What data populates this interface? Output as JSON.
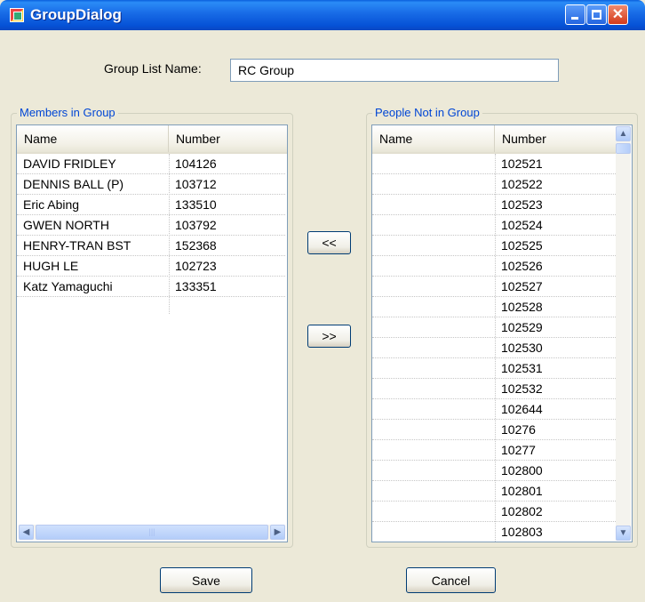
{
  "window": {
    "title": "GroupDialog"
  },
  "form": {
    "group_name_label": "Group List Name:",
    "group_name_value": "RC Group"
  },
  "members": {
    "legend": "Members in Group",
    "columns": [
      "Name",
      "Number"
    ],
    "rows": [
      {
        "name": "DAVID FRIDLEY",
        "number": "104126"
      },
      {
        "name": "DENNIS BALL (P)",
        "number": "103712"
      },
      {
        "name": "Eric Abing",
        "number": "133510"
      },
      {
        "name": "GWEN NORTH",
        "number": "103792"
      },
      {
        "name": "HENRY-TRAN BST",
        "number": "152368"
      },
      {
        "name": "HUGH LE",
        "number": "102723"
      },
      {
        "name": "Katz Yamaguchi",
        "number": "133351"
      }
    ]
  },
  "nonmembers": {
    "legend": "People Not in Group",
    "columns": [
      "Name",
      "Number"
    ],
    "rows": [
      {
        "name": "",
        "number": "102521"
      },
      {
        "name": "",
        "number": "102522"
      },
      {
        "name": "",
        "number": "102523"
      },
      {
        "name": "",
        "number": "102524"
      },
      {
        "name": "",
        "number": "102525"
      },
      {
        "name": "",
        "number": "102526"
      },
      {
        "name": "",
        "number": "102527"
      },
      {
        "name": "",
        "number": "102528"
      },
      {
        "name": "",
        "number": "102529"
      },
      {
        "name": "",
        "number": "102530"
      },
      {
        "name": "",
        "number": "102531"
      },
      {
        "name": "",
        "number": "102532"
      },
      {
        "name": "",
        "number": "102644"
      },
      {
        "name": "",
        "number": "10276"
      },
      {
        "name": "",
        "number": "10277"
      },
      {
        "name": "",
        "number": "102800"
      },
      {
        "name": "",
        "number": "102801"
      },
      {
        "name": "",
        "number": "102802"
      },
      {
        "name": "",
        "number": "102803"
      }
    ]
  },
  "buttons": {
    "add": "<<",
    "remove": ">>",
    "save": "Save",
    "cancel": "Cancel"
  },
  "icons": {
    "app": "app-icon",
    "minimize": "minimize-icon",
    "maximize": "maximize-icon",
    "close": "close-icon",
    "scroll_left": "scroll-left-arrow-icon",
    "scroll_right": "scroll-right-arrow-icon",
    "scroll_up": "scroll-up-arrow-icon",
    "scroll_down": "scroll-down-arrow-icon"
  },
  "colors": {
    "titlebar": "#0a5fdc",
    "legend_text": "#0046d5",
    "dialog_bg": "#ece9d8"
  }
}
